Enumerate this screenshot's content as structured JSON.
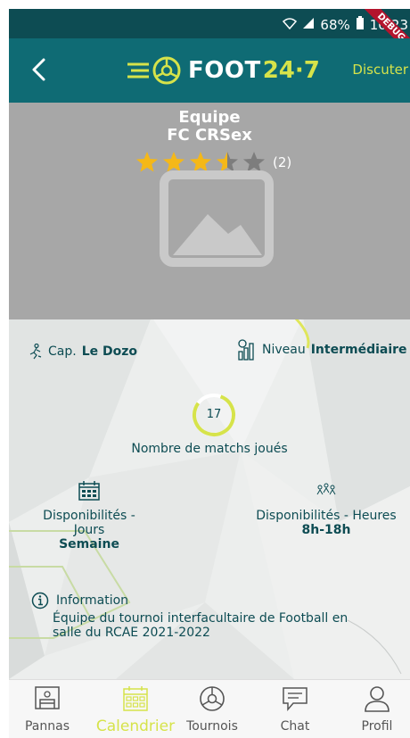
{
  "status": {
    "battery_pct": "68%",
    "time": "10:23",
    "debug_label": "DEBUG"
  },
  "header": {
    "logo_main": "FOOT",
    "logo_num": "24·7",
    "chat_link": "Discuter"
  },
  "team": {
    "label": "Equipe",
    "name": "FC CRSex",
    "rating": 3.5,
    "rating_count": "(2)"
  },
  "captain": {
    "label": "Cap.",
    "value": "Le Dozo"
  },
  "level": {
    "label": "Niveau",
    "value": "Intermédiaire"
  },
  "matches": {
    "count": "17",
    "label": "Nombre de matchs joués"
  },
  "availability_days": {
    "label": "Disponibilités - Jours",
    "value": "Semaine"
  },
  "availability_hours": {
    "label": "Disponibilités - Heures",
    "value": "8h-18h"
  },
  "info": {
    "label": "Information",
    "text": "Équipe du tournoi interfacultaire de Football en salle du RCAE 2021-2022"
  },
  "nav": [
    {
      "label": "Pannas",
      "icon": "pannas-icon"
    },
    {
      "label": "Calendrier",
      "icon": "calendar-icon"
    },
    {
      "label": "Tournois",
      "icon": "ball-icon"
    },
    {
      "label": "Chat",
      "icon": "chat-icon"
    },
    {
      "label": "Profil",
      "icon": "user-icon"
    }
  ],
  "colors": {
    "primary": "#0f6b74",
    "status": "#0d4c53",
    "accent": "#d6e34a",
    "star": "#f5b818"
  }
}
